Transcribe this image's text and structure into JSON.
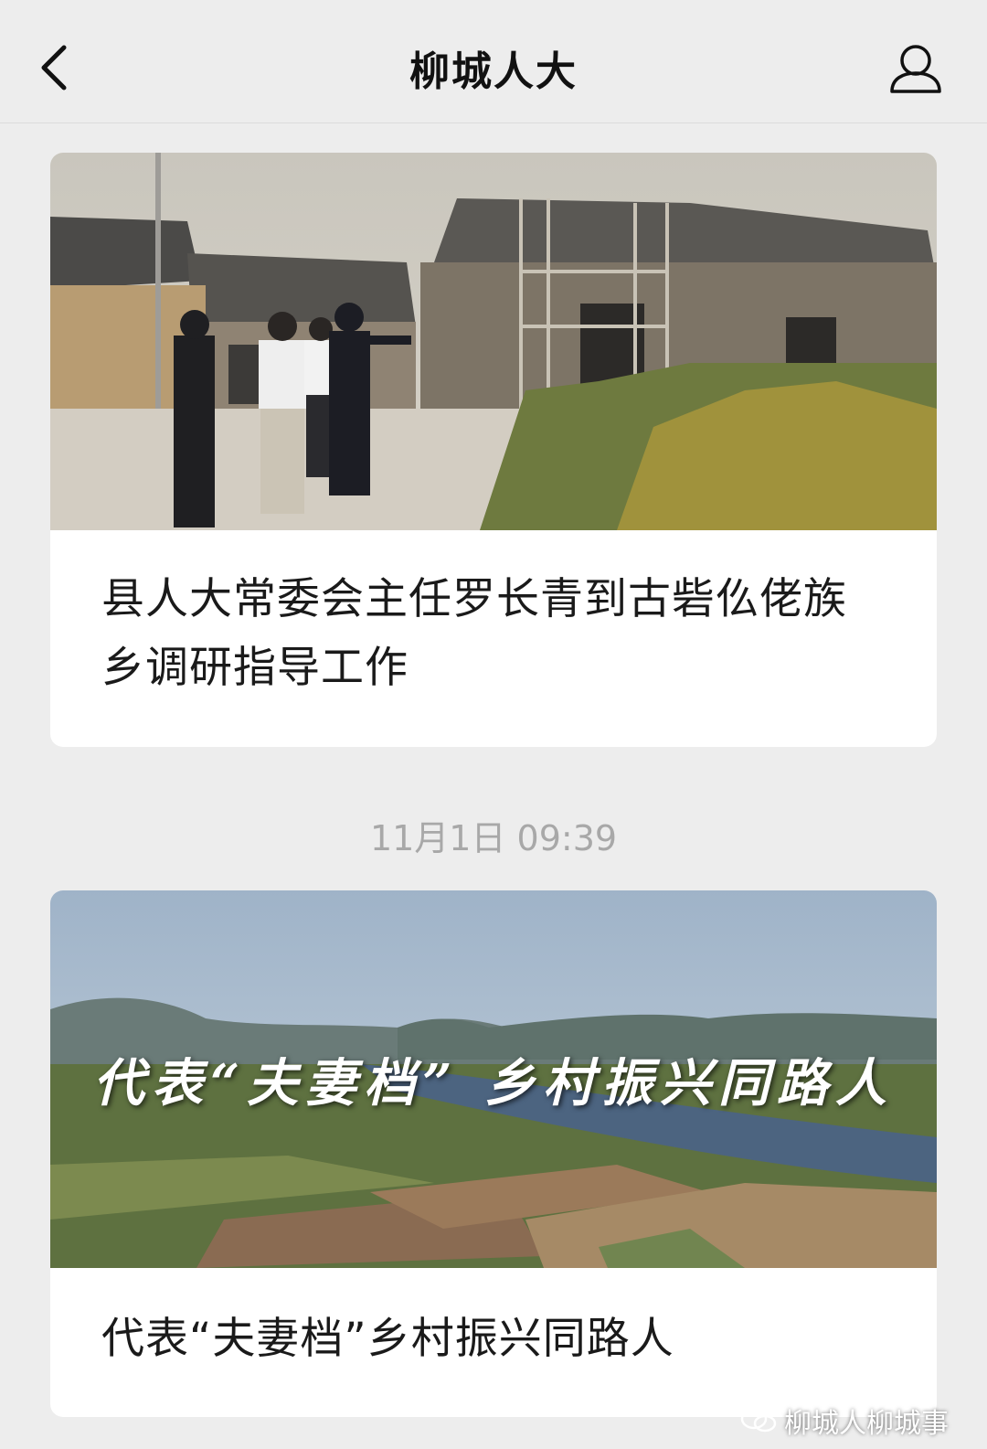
{
  "header": {
    "title": "柳城人大"
  },
  "articles": [
    {
      "title": "县人大常委会主任罗长青到古砦仫佬族乡调研指导工作",
      "image": "village-inspection-photo"
    },
    {
      "title": "代表“夫妻档”乡村振兴同路人",
      "image": "river-farmland-aerial-photo",
      "image_overlay_text": "代表“夫妻档” 乡村振兴同路人"
    }
  ],
  "timestamp": "11月1日 09:39",
  "watermark": "柳城人柳城事",
  "colors": {
    "background": "#ededed",
    "card": "#ffffff",
    "timestamp": "#a8a8a8"
  }
}
